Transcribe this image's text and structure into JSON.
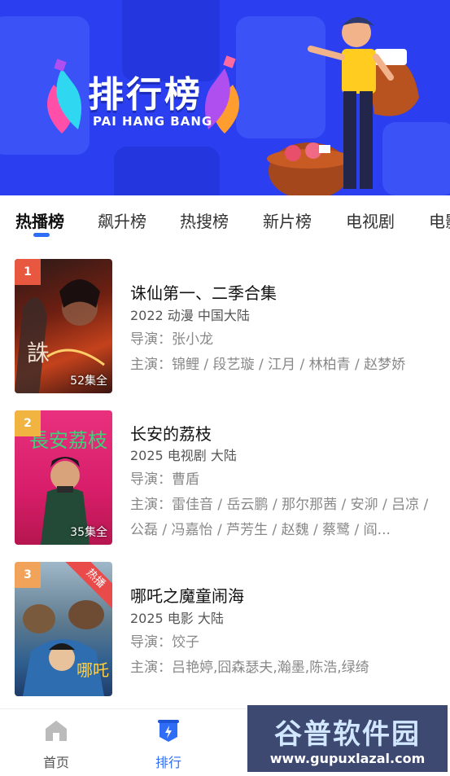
{
  "banner": {
    "title": "排行榜",
    "subtitle": "PAI HANG BANG"
  },
  "tabs": [
    {
      "label": "热播榜",
      "active": true
    },
    {
      "label": "飙升榜",
      "active": false
    },
    {
      "label": "热搜榜",
      "active": false
    },
    {
      "label": "新片榜",
      "active": false
    },
    {
      "label": "电视剧",
      "active": false
    },
    {
      "label": "电影",
      "active": false
    }
  ],
  "items": [
    {
      "rank": "1",
      "rank_color": "#e8573f",
      "episodes": "52集全",
      "title": "诛仙第一、二季合集",
      "meta": "2022  动漫  中国大陆",
      "director": "导演：张小龙",
      "cast": "主演：锦鲤 / 段艺璇 / 江月 / 林柏青 / 赵梦娇"
    },
    {
      "rank": "2",
      "rank_color": "#f2b441",
      "episodes": "35集全",
      "title": "长安的荔枝",
      "meta": "2025  电视剧  大陆",
      "director": "导演：曹盾",
      "cast": "主演：雷佳音 / 岳云鹏 / 那尔那茜 / 安泖 / 吕凉 / 公磊 / 冯嘉怡 / 芦芳生 / 赵魏 / 蔡鹭 / 阎..."
    },
    {
      "rank": "3",
      "rank_color": "#f2a35a",
      "ribbon": "热播",
      "title": "哪吒之魔童闹海",
      "meta": "2025  电影  大陆",
      "director": "导演：饺子",
      "cast": "主演：吕艳婷,囧森瑟夫,瀚墨,陈浩,绿绮"
    }
  ],
  "nav": [
    {
      "label": "首页",
      "icon": "home-icon",
      "active": false
    },
    {
      "label": "排行",
      "icon": "ranking-icon",
      "active": true
    }
  ],
  "watermark": {
    "title": "谷普软件园",
    "url": "www.gupuxlazal.com"
  },
  "colors": {
    "accent": "#2f6df6",
    "banner_bg": "#2b3ff0",
    "ribbon": "#e94a4a"
  }
}
